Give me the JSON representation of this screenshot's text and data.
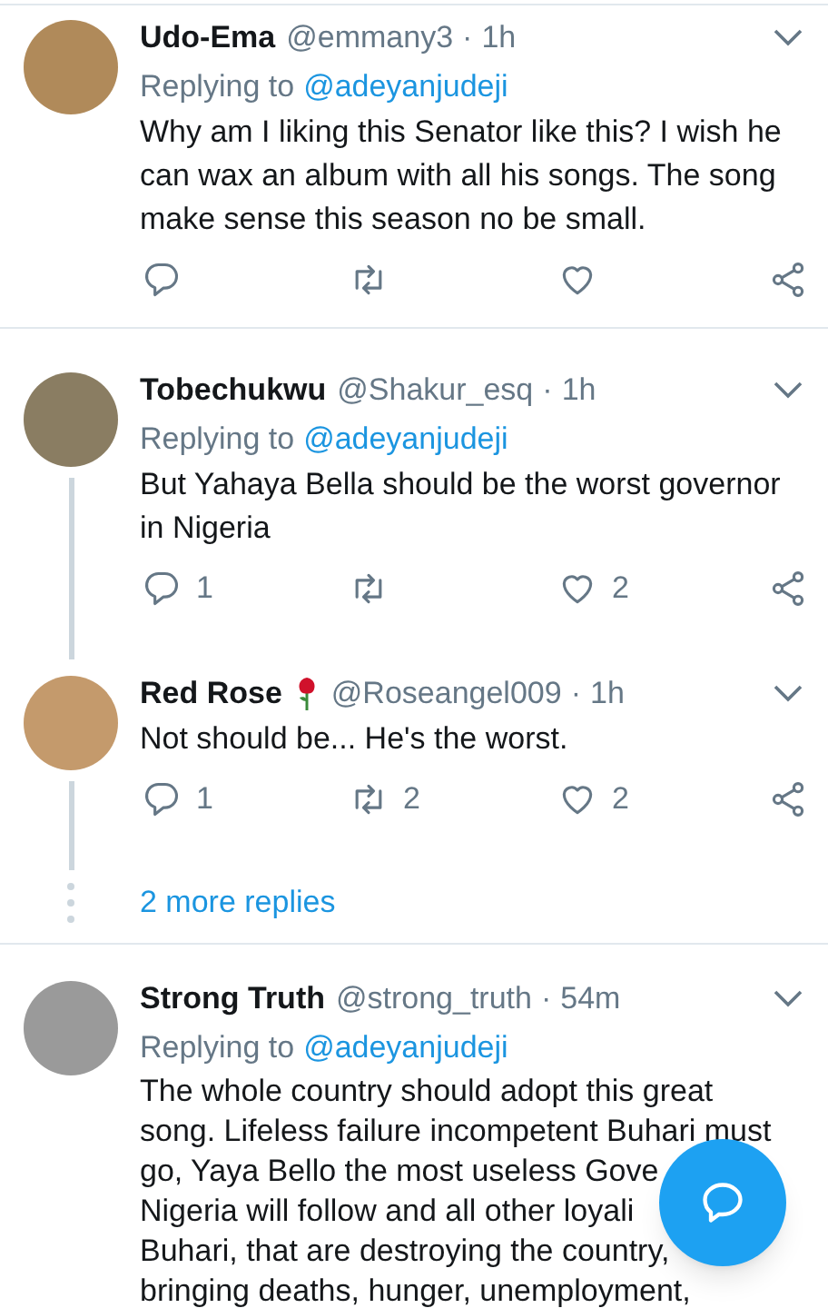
{
  "items": [
    {
      "kind": "tweet",
      "name": "Udo-Ema",
      "name_icon": false,
      "handle": "@emmany3",
      "separator": "·",
      "time": "1h",
      "replying_label": "Replying to",
      "replying_to": "@adeyanjudeji",
      "text": "Why am I liking this Senator like this? I wish he can wax an album with all his songs. The song make sense this season no be small.",
      "thread_continues": false,
      "actions_visible": true
    },
    {
      "kind": "tweet",
      "name": "Tobechukwu",
      "name_icon": false,
      "handle": "@Shakur_esq",
      "separator": "·",
      "time": "1h",
      "replying_label": "Replying to",
      "replying_to": "@adeyanjudeji",
      "text": "But Yahaya Bella should be the worst governor in Nigeria",
      "thread_continues": true,
      "actions_visible": true,
      "reply_count": "1",
      "like_count": "2"
    },
    {
      "kind": "tweet",
      "name": "Red Rose",
      "name_icon": true,
      "handle": "@Roseangel009",
      "separator": "·",
      "time": "1h",
      "text": "Not should be... He's the worst.",
      "thread_continues": true,
      "actions_visible": true,
      "reply_count": "1",
      "retweet_count": "2",
      "like_count": "2"
    },
    {
      "kind": "more",
      "text": "2 more replies"
    },
    {
      "kind": "tweet",
      "name": "Strong Truth",
      "name_icon": false,
      "handle": "@strong_truth",
      "separator": "·",
      "time": "54m",
      "replying_label": "Replying to",
      "replying_to": "@adeyanjudeji",
      "text_lines": [
        "The whole country should adopt this great",
        "song. Lifeless failure incompetent Buhari must",
        "go, Yaya Bello the most useless Gove",
        "Nigeria will follow and all other loyali",
        "Buhari, that are destroying the country,",
        "bringing deaths, hunger, unemployment,"
      ],
      "thread_continues": false,
      "actions_visible": false
    }
  ]
}
